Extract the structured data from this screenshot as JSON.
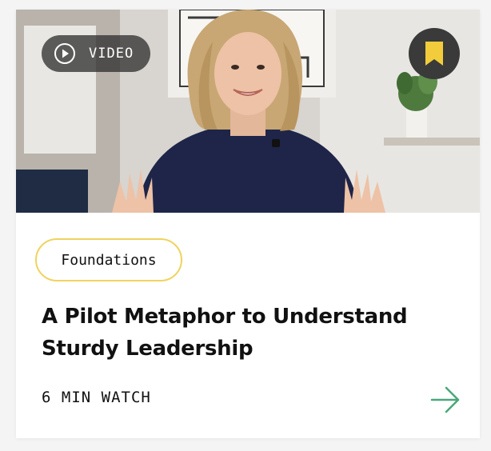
{
  "card": {
    "media_badge": {
      "label": "VIDEO",
      "icon": "play-circle-icon"
    },
    "bookmark": {
      "icon": "bookmark-icon",
      "color": "#f2cc3a"
    },
    "category_tag": "Foundations",
    "title": "A Pilot Metaphor to Understand Sturdy Leadership",
    "duration": "6 MIN WATCH",
    "link_icon": "arrow-right-icon"
  },
  "colors": {
    "tag_border": "#efd35f",
    "arrow": "#4aa77a",
    "badge_bg": "#323232"
  }
}
